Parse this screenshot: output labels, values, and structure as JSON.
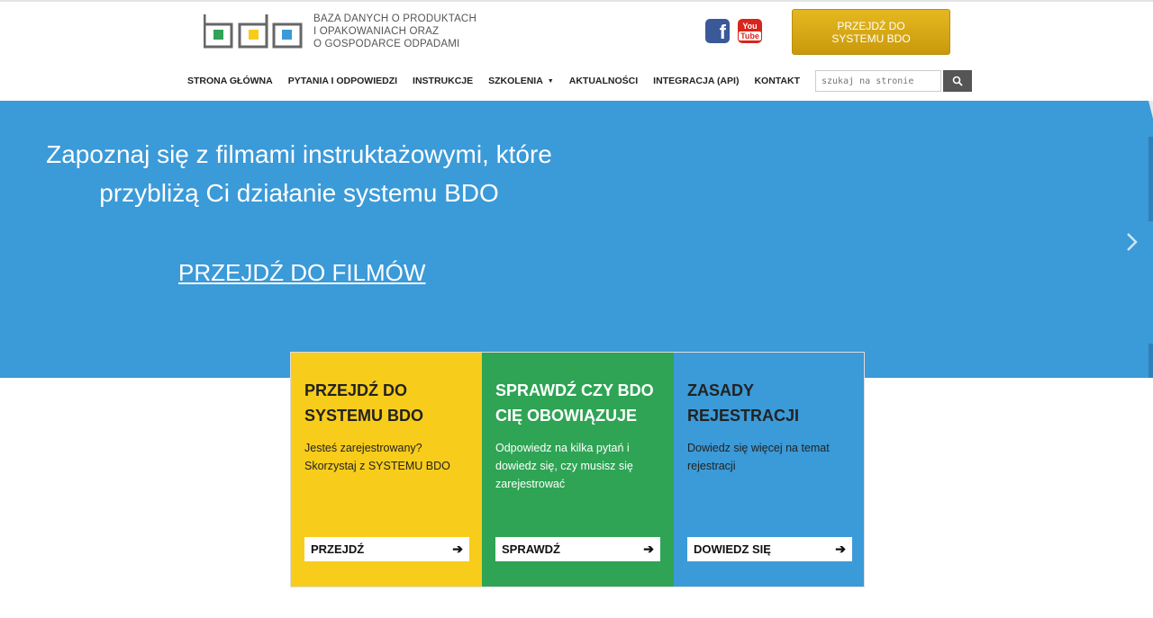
{
  "header": {
    "logo_lines": [
      "BAZA DANYCH O PRODUKTACH",
      "I OPAKOWANIACH ORAZ",
      "O GOSPODARCE ODPADAMI"
    ],
    "facebook_glyph": "f",
    "youtube_you": "You",
    "youtube_tube": "Tube",
    "cta_label": "PRZEJDŹ DO SYSTEMU BDO",
    "logo_colors": {
      "green": "#2ea454",
      "yellow": "#f8cc1b",
      "blue": "#3b9ad8",
      "frame": "#666666"
    }
  },
  "nav": {
    "items": [
      {
        "label": "STRONA GŁÓWNA"
      },
      {
        "label": "PYTANIA I ODPOWIEDZI"
      },
      {
        "label": "INSTRUKCJE"
      },
      {
        "label": "SZKOLENIA",
        "caret": "▼"
      },
      {
        "label": "AKTUALNOŚCI"
      },
      {
        "label": "INTEGRACJA (API)"
      },
      {
        "label": "KONTAKT"
      }
    ],
    "search_placeholder": "szukaj na stronie",
    "search_icon": "search-icon"
  },
  "hero": {
    "title": "Zapoznaj się z filmami instruktażowymi, które przybliżą Ci działanie systemu BDO",
    "link": "PRZEJDŹ DO FILMÓW",
    "next_icon": "chevron-right-icon",
    "background": "#3b9ad8"
  },
  "cards": [
    {
      "title_line1": "PRZEJDŹ DO",
      "title_line2": "SYSTEMU BDO",
      "text": "Jesteś zarejestrowany? Skorzystaj z SYSTEMU BDO",
      "button": "PRZEJDŹ",
      "arrow": "➔"
    },
    {
      "title_line1": "SPRAWDŹ CZY BDO",
      "title_line2": "CIĘ OBOWIĄZUJE",
      "text": "Odpowiedz na kilka pytań i dowiedz się, czy musisz się zarejestrować",
      "button": "SPRAWDŹ",
      "arrow": "➔"
    },
    {
      "title_line1": "ZASADY",
      "title_line2": "REJESTRACJI",
      "text": "Dowiedz się więcej na temat rejestracji",
      "button": "DOWIEDZ SIĘ",
      "arrow": "➔"
    }
  ]
}
